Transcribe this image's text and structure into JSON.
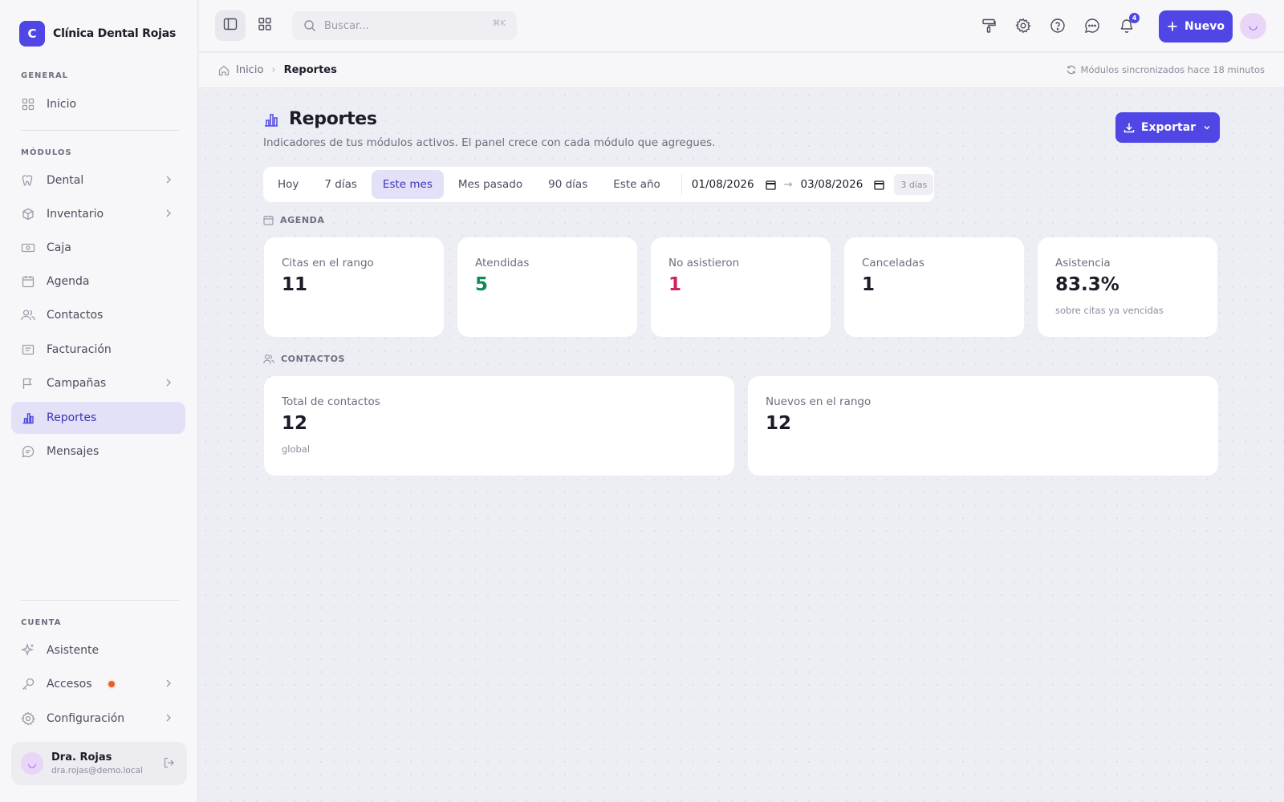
{
  "brand": {
    "initial": "C",
    "name": "Clínica Dental Rojas"
  },
  "sidebar": {
    "general_label": "GENERAL",
    "modules_label": "MÓDULOS",
    "account_label": "CUENTA",
    "general_items": [
      {
        "label": "Inicio",
        "icon": "grid-icon"
      }
    ],
    "module_items": [
      {
        "label": "Dental",
        "icon": "tooth-icon",
        "has_submenu": true
      },
      {
        "label": "Inventario",
        "icon": "box-icon",
        "has_submenu": true
      },
      {
        "label": "Caja",
        "icon": "cash-icon",
        "has_submenu": false
      },
      {
        "label": "Agenda",
        "icon": "calendar-icon",
        "has_submenu": false
      },
      {
        "label": "Contactos",
        "icon": "users-icon",
        "has_submenu": false
      },
      {
        "label": "Facturación",
        "icon": "invoice-icon",
        "has_submenu": false
      },
      {
        "label": "Campañas",
        "icon": "flag-icon",
        "has_submenu": true
      },
      {
        "label": "Reportes",
        "icon": "bar-chart-icon",
        "has_submenu": false,
        "active": true
      },
      {
        "label": "Mensajes",
        "icon": "message-icon",
        "has_submenu": false
      }
    ],
    "account_items": [
      {
        "label": "Asistente",
        "icon": "sparkle-icon",
        "has_submenu": false
      },
      {
        "label": "Accesos",
        "icon": "key-icon",
        "has_submenu": true,
        "alert_dot": true
      },
      {
        "label": "Configuración",
        "icon": "gear-icon",
        "has_submenu": true
      }
    ],
    "user": {
      "name": "Dra. Rojas",
      "email": "dra.rojas@demo.local"
    }
  },
  "topbar": {
    "search_placeholder": "Buscar...",
    "search_shortcut": "⌘K",
    "notifications_count": "4",
    "new_label": "Nuevo"
  },
  "breadcrumb": {
    "home": "Inicio",
    "current": "Reportes",
    "sync_status": "Módulos sincronizados hace 18 minutos"
  },
  "page": {
    "title": "Reportes",
    "subtitle": "Indicadores de tus módulos activos. El panel crece con cada módulo que agregues.",
    "export_label": "Exportar"
  },
  "range": {
    "options": [
      "Hoy",
      "7 días",
      "Este mes",
      "Mes pasado",
      "90 días",
      "Este año"
    ],
    "active": "Este mes",
    "from": "01/08/2026",
    "to": "03/08/2026",
    "days": "3 días"
  },
  "agenda": {
    "label": "AGENDA",
    "cards": [
      {
        "label": "Citas en el rango",
        "value": "11",
        "note": ""
      },
      {
        "label": "Atendidas",
        "value": "5",
        "note": ""
      },
      {
        "label": "No asistieron",
        "value": "1",
        "note": ""
      },
      {
        "label": "Canceladas",
        "value": "1",
        "note": ""
      },
      {
        "label": "Asistencia",
        "value": "83.3%",
        "note": "sobre citas ya vencidas"
      }
    ]
  },
  "contacts": {
    "label": "CONTACTOS",
    "cards": [
      {
        "label": "Total de contactos",
        "value": "12",
        "note": "global"
      },
      {
        "label": "Nuevos en el rango",
        "value": "12",
        "note": ""
      }
    ]
  },
  "colors": {
    "accent": "#4f46e5",
    "positive": "#0f8a55",
    "negative": "#d0245c"
  }
}
